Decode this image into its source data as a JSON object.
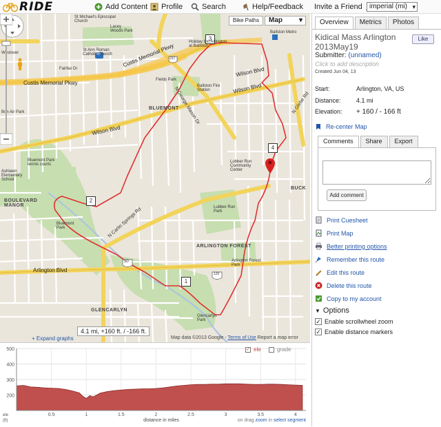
{
  "header": {
    "logo_text": "RIDE",
    "nav": [
      {
        "label": "Add Content",
        "icon": "add-content-icon"
      },
      {
        "label": "Profile",
        "icon": "profile-icon"
      },
      {
        "label": "Search",
        "icon": "search-icon"
      },
      {
        "label": "Help/Feedback",
        "icon": "help-icon"
      },
      {
        "label": "Invite a Friend",
        "icon": "invite-icon"
      }
    ],
    "units_selected": "imperial (mi)"
  },
  "map": {
    "map_type": "Map",
    "bike_paths": "Bike Paths",
    "labels": {
      "custis1": "Custis Memorial Pkwy",
      "custis2": "Custis Memorial Pkwy",
      "wilson1": "Wilson Blvd",
      "wilson2": "Wilson Blvd",
      "wilson3": "Wilson Blvd",
      "arlington": "Arlington Blvd",
      "carlin": "N Carlin Springs Rd",
      "george": "N George Mason Dr",
      "glebe": "N Glebe Rd",
      "bluemont": "BLUEMONT",
      "arlforest": "ARLINGTON FOREST",
      "glencarlyn": "GLENCARLYN",
      "boulevard": "BOULEVARD MANOR",
      "buck": "BUCK",
      "ballston": "Ballston Metro",
      "holiday": "Holiday Inn Arlington at Ballston",
      "stmichael": "St Michael's Episcopal Church",
      "laceywoods": "Lacey Woods Park",
      "stann": "St Ann Roman Catholic Church",
      "fields": "Fields Park",
      "firestation": "Ballston Fire Station",
      "bluemontpark": "Bluemont Park tennis courts",
      "ashlawn": "Ashlawn Elementary School",
      "lubber": "Lubber Run Community Center",
      "lubberpark": "Lubber Run Park",
      "glencarlynpark": "Glencarlyn Park",
      "westover": "Westover",
      "bonair": "Bon Air Park",
      "fairfax": "Fairfax Dr",
      "bluemontp2": "Bluemont Park",
      "forestpark": "Arlington Forest Park"
    },
    "markers": [
      "1",
      "2",
      "3",
      "4"
    ],
    "shields": [
      "50",
      "66",
      "237",
      "120"
    ],
    "hover_readout": "4.1 mi, +160 ft. / -166 ft.",
    "attribution": "Map data ©2013 Google -",
    "terms": "Terms of Use",
    "report": "Report a map error",
    "expand": "+ Expand graphs"
  },
  "panel": {
    "tabs": [
      "Overview",
      "Metrics",
      "Photos"
    ],
    "title": "Kidical Mass Arlington 2013May19",
    "like": "Like",
    "submitter_label": "Submitter:",
    "submitter_name": "(unnamed)",
    "add_description": "Click to add description",
    "created": "Created Jun 04, 13",
    "start_label": "Start:",
    "start_value": "Arlington, VA, US",
    "distance_label": "Distance:",
    "distance_value": "4.1 mi",
    "elevation_label": "Elevation:",
    "elevation_value": "+ 160 / - 166 ft",
    "recenter": "Re-center Map",
    "comment_tabs": [
      "Comments",
      "Share",
      "Export"
    ],
    "add_comment": "Add comment",
    "actions": [
      {
        "label": "Print Cuesheet",
        "icon": "print-cuesheet-icon"
      },
      {
        "label": "Print Map",
        "icon": "print-map-icon"
      },
      {
        "label": "Better printing options",
        "icon": "printer-icon"
      },
      {
        "label": "Remember this route",
        "icon": "bookmark-icon"
      },
      {
        "label": "Edit this route",
        "icon": "pencil-icon"
      },
      {
        "label": "Delete this route",
        "icon": "delete-icon"
      },
      {
        "label": "Copy to my account",
        "icon": "copy-icon"
      }
    ],
    "options_title": "Options",
    "options": [
      {
        "label": "Enable scrollwheel zoom",
        "checked": true
      },
      {
        "label": "Enable distance markers",
        "checked": true
      }
    ]
  },
  "graph": {
    "legend_ele": "ele",
    "legend_grade": "grade",
    "y_ticks": [
      "500",
      "400",
      "300",
      "200"
    ],
    "x_ticks": [
      "0.5",
      "1",
      "1.5",
      "2",
      "2.5",
      "3",
      "3.5",
      "4"
    ],
    "ele_unit": "ele (ft)",
    "x_label": "distance in miles",
    "hint_prefix": "on drag",
    "hint_zoom": "zoom",
    "hint_in": "in",
    "hint_select": "select segment",
    "fill_color": "#c0504d",
    "profile": [
      [
        0.0,
        258
      ],
      [
        0.1,
        262
      ],
      [
        0.2,
        252
      ],
      [
        0.3,
        250
      ],
      [
        0.4,
        246
      ],
      [
        0.5,
        244
      ],
      [
        0.6,
        242
      ],
      [
        0.7,
        236
      ],
      [
        0.8,
        226
      ],
      [
        0.9,
        214
      ],
      [
        0.95,
        192
      ],
      [
        1.0,
        178
      ],
      [
        1.05,
        196
      ],
      [
        1.1,
        188
      ],
      [
        1.15,
        200
      ],
      [
        1.2,
        212
      ],
      [
        1.3,
        222
      ],
      [
        1.4,
        228
      ],
      [
        1.5,
        232
      ],
      [
        1.6,
        236
      ],
      [
        1.7,
        238
      ],
      [
        1.8,
        240
      ],
      [
        1.9,
        240
      ],
      [
        2.0,
        242
      ],
      [
        2.1,
        246
      ],
      [
        2.2,
        252
      ],
      [
        2.3,
        258
      ],
      [
        2.4,
        262
      ],
      [
        2.5,
        266
      ],
      [
        2.6,
        268
      ],
      [
        2.7,
        268
      ],
      [
        2.8,
        270
      ],
      [
        2.9,
        270
      ],
      [
        3.0,
        272
      ],
      [
        3.1,
        272
      ],
      [
        3.2,
        272
      ],
      [
        3.3,
        270
      ],
      [
        3.4,
        268
      ],
      [
        3.5,
        268
      ],
      [
        3.6,
        270
      ],
      [
        3.7,
        270
      ],
      [
        3.8,
        268
      ],
      [
        3.9,
        266
      ],
      [
        4.0,
        264
      ],
      [
        4.1,
        262
      ]
    ],
    "ylim": [
      100,
      500
    ],
    "xlim": [
      0,
      4.15
    ]
  }
}
